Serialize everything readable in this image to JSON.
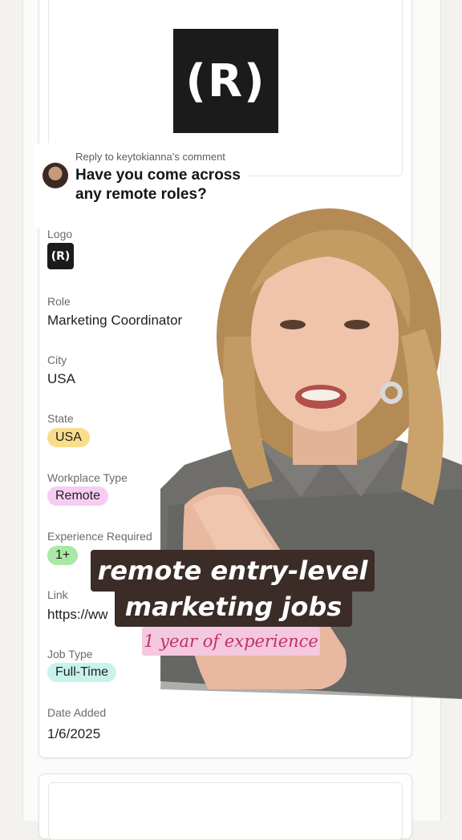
{
  "reply": {
    "meta": "Reply to keytokianna’s comment",
    "text": "Have you come across any remote roles?"
  },
  "logo_glyph": "(R)",
  "fields": {
    "logo_label": "Logo",
    "role_label": "Role",
    "role_value": "Marketing Coordinator",
    "city_label": "City",
    "city_value": "USA",
    "state_label": "State",
    "state_value": "USA",
    "workplace_label": "Workplace Type",
    "workplace_value": "Remote",
    "experience_label": "Experience Required",
    "experience_value": "1+",
    "link_label": "Link",
    "link_value": "https://ww",
    "jobtype_label": "Job Type",
    "jobtype_value": "Full-Time",
    "date_label": "Date Added",
    "date_value": "1/6/2025"
  },
  "caption": {
    "line1": "remote entry-level",
    "line2": "marketing jobs",
    "line3": "1 year of experience"
  },
  "colors": {
    "state_pill": "#f8dd8b",
    "remote_pill": "#f5cdf2",
    "experience_pill": "#a9e9a3",
    "jobtype_pill": "#c9f2ea",
    "caption_bg": "#3b2c28",
    "subcaption_bg": "#f4c8dd"
  }
}
